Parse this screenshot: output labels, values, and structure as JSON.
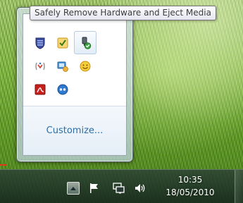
{
  "tooltip": {
    "text": "Safely Remove Hardware and Eject Media"
  },
  "tray_overflow": {
    "icons": [
      "security-shield-icon",
      "calendar-checklist-icon",
      "safely-remove-hardware-icon",
      "network-activity-icon",
      "display-settings-icon",
      "smiley-messenger-icon",
      "pdf-reader-icon",
      "remote-chat-icon"
    ],
    "active_icon": "safely-remove-hardware-icon",
    "customize_label": "Customize..."
  },
  "taskbar": {
    "clock": {
      "time": "10:35",
      "date": "18/05/2010"
    },
    "tray_icons": [
      "show-hidden-icons-arrow",
      "action-center-flag-icon",
      "network-icon",
      "volume-icon"
    ]
  },
  "colors": {
    "link": "#2b6eaa",
    "accent_red": "#e8341c",
    "taskbar": "#1e322c"
  }
}
